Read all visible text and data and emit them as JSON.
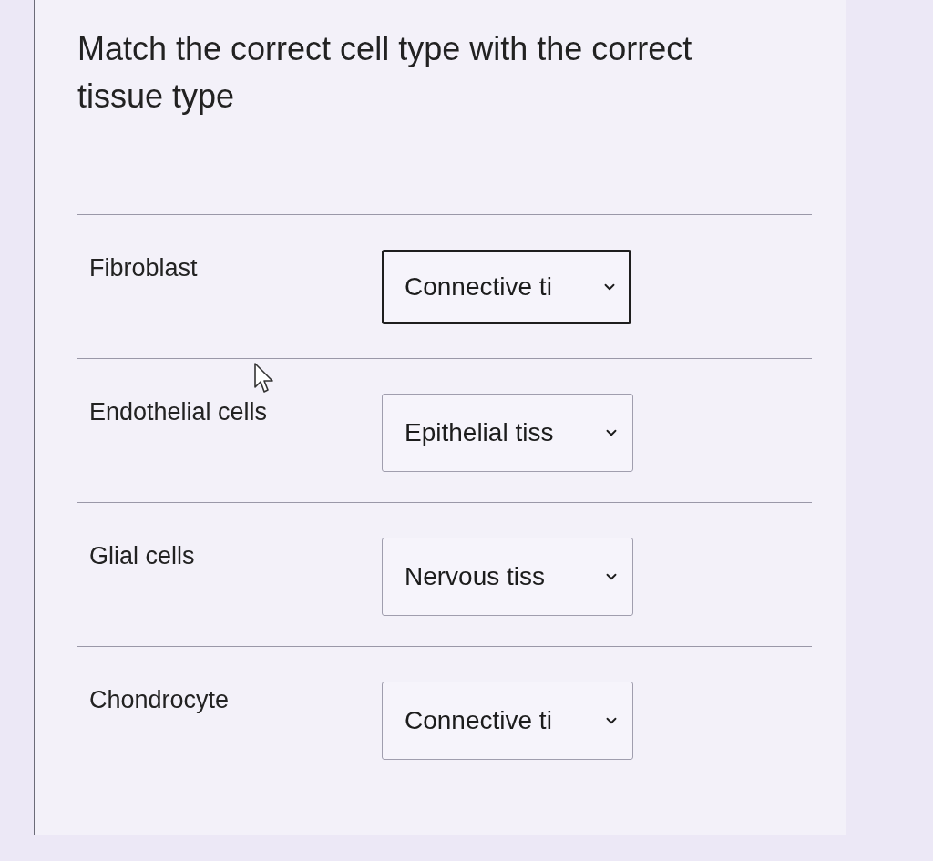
{
  "question": {
    "text": "Match the correct cell type with the correct tissue type"
  },
  "rows": [
    {
      "term": "Fibroblast",
      "answer": "Connective ti",
      "focused": true
    },
    {
      "term": "Endothelial cells",
      "answer": "Epithelial tiss",
      "focused": false
    },
    {
      "term": "Glial cells",
      "answer": "Nervous tiss",
      "focused": false
    },
    {
      "term": "Chondrocyte",
      "answer": "Connective ti",
      "focused": false
    }
  ]
}
